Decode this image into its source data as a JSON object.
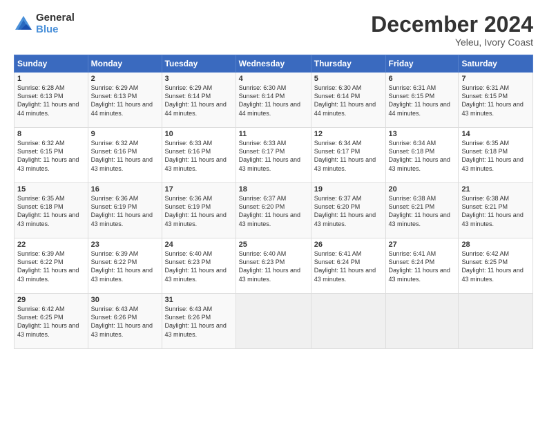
{
  "header": {
    "logo_general": "General",
    "logo_blue": "Blue",
    "month_title": "December 2024",
    "location": "Yeleu, Ivory Coast"
  },
  "weekdays": [
    "Sunday",
    "Monday",
    "Tuesday",
    "Wednesday",
    "Thursday",
    "Friday",
    "Saturday"
  ],
  "weeks": [
    [
      {
        "day": "1",
        "sunrise": "6:28 AM",
        "sunset": "6:13 PM",
        "daylight": "11 hours and 44 minutes."
      },
      {
        "day": "2",
        "sunrise": "6:29 AM",
        "sunset": "6:13 PM",
        "daylight": "11 hours and 44 minutes."
      },
      {
        "day": "3",
        "sunrise": "6:29 AM",
        "sunset": "6:14 PM",
        "daylight": "11 hours and 44 minutes."
      },
      {
        "day": "4",
        "sunrise": "6:30 AM",
        "sunset": "6:14 PM",
        "daylight": "11 hours and 44 minutes."
      },
      {
        "day": "5",
        "sunrise": "6:30 AM",
        "sunset": "6:14 PM",
        "daylight": "11 hours and 44 minutes."
      },
      {
        "day": "6",
        "sunrise": "6:31 AM",
        "sunset": "6:15 PM",
        "daylight": "11 hours and 44 minutes."
      },
      {
        "day": "7",
        "sunrise": "6:31 AM",
        "sunset": "6:15 PM",
        "daylight": "11 hours and 43 minutes."
      }
    ],
    [
      {
        "day": "8",
        "sunrise": "6:32 AM",
        "sunset": "6:15 PM",
        "daylight": "11 hours and 43 minutes."
      },
      {
        "day": "9",
        "sunrise": "6:32 AM",
        "sunset": "6:16 PM",
        "daylight": "11 hours and 43 minutes."
      },
      {
        "day": "10",
        "sunrise": "6:33 AM",
        "sunset": "6:16 PM",
        "daylight": "11 hours and 43 minutes."
      },
      {
        "day": "11",
        "sunrise": "6:33 AM",
        "sunset": "6:17 PM",
        "daylight": "11 hours and 43 minutes."
      },
      {
        "day": "12",
        "sunrise": "6:34 AM",
        "sunset": "6:17 PM",
        "daylight": "11 hours and 43 minutes."
      },
      {
        "day": "13",
        "sunrise": "6:34 AM",
        "sunset": "6:18 PM",
        "daylight": "11 hours and 43 minutes."
      },
      {
        "day": "14",
        "sunrise": "6:35 AM",
        "sunset": "6:18 PM",
        "daylight": "11 hours and 43 minutes."
      }
    ],
    [
      {
        "day": "15",
        "sunrise": "6:35 AM",
        "sunset": "6:18 PM",
        "daylight": "11 hours and 43 minutes."
      },
      {
        "day": "16",
        "sunrise": "6:36 AM",
        "sunset": "6:19 PM",
        "daylight": "11 hours and 43 minutes."
      },
      {
        "day": "17",
        "sunrise": "6:36 AM",
        "sunset": "6:19 PM",
        "daylight": "11 hours and 43 minutes."
      },
      {
        "day": "18",
        "sunrise": "6:37 AM",
        "sunset": "6:20 PM",
        "daylight": "11 hours and 43 minutes."
      },
      {
        "day": "19",
        "sunrise": "6:37 AM",
        "sunset": "6:20 PM",
        "daylight": "11 hours and 43 minutes."
      },
      {
        "day": "20",
        "sunrise": "6:38 AM",
        "sunset": "6:21 PM",
        "daylight": "11 hours and 43 minutes."
      },
      {
        "day": "21",
        "sunrise": "6:38 AM",
        "sunset": "6:21 PM",
        "daylight": "11 hours and 43 minutes."
      }
    ],
    [
      {
        "day": "22",
        "sunrise": "6:39 AM",
        "sunset": "6:22 PM",
        "daylight": "11 hours and 43 minutes."
      },
      {
        "day": "23",
        "sunrise": "6:39 AM",
        "sunset": "6:22 PM",
        "daylight": "11 hours and 43 minutes."
      },
      {
        "day": "24",
        "sunrise": "6:40 AM",
        "sunset": "6:23 PM",
        "daylight": "11 hours and 43 minutes."
      },
      {
        "day": "25",
        "sunrise": "6:40 AM",
        "sunset": "6:23 PM",
        "daylight": "11 hours and 43 minutes."
      },
      {
        "day": "26",
        "sunrise": "6:41 AM",
        "sunset": "6:24 PM",
        "daylight": "11 hours and 43 minutes."
      },
      {
        "day": "27",
        "sunrise": "6:41 AM",
        "sunset": "6:24 PM",
        "daylight": "11 hours and 43 minutes."
      },
      {
        "day": "28",
        "sunrise": "6:42 AM",
        "sunset": "6:25 PM",
        "daylight": "11 hours and 43 minutes."
      }
    ],
    [
      {
        "day": "29",
        "sunrise": "6:42 AM",
        "sunset": "6:25 PM",
        "daylight": "11 hours and 43 minutes."
      },
      {
        "day": "30",
        "sunrise": "6:43 AM",
        "sunset": "6:26 PM",
        "daylight": "11 hours and 43 minutes."
      },
      {
        "day": "31",
        "sunrise": "6:43 AM",
        "sunset": "6:26 PM",
        "daylight": "11 hours and 43 minutes."
      },
      null,
      null,
      null,
      null
    ]
  ]
}
